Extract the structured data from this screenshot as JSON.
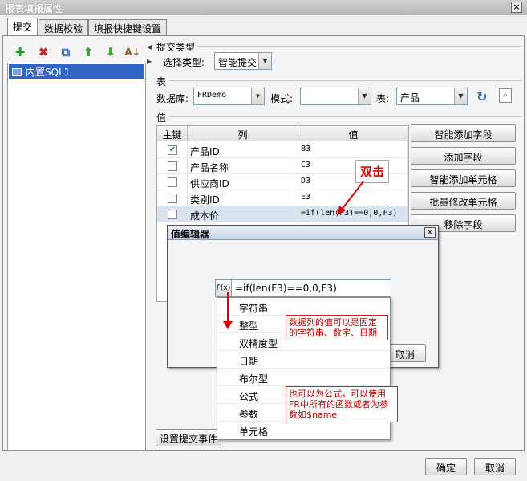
{
  "window": {
    "title": "报表填报属性",
    "close_glyph": "×"
  },
  "tabs": [
    {
      "label": "提交"
    },
    {
      "label": "数据校验"
    },
    {
      "label": "填报快捷键设置"
    }
  ],
  "left_toolbar": {
    "icons": [
      "add-icon",
      "delete-icon",
      "copy-icon",
      "move-up-icon",
      "move-down-icon",
      "sort-icon"
    ]
  },
  "left_list": {
    "items": [
      {
        "label": "内置SQL1"
      }
    ]
  },
  "submit_type": {
    "section": "提交类型",
    "label": "选择类型:",
    "value": "智能提交"
  },
  "table_section": {
    "section": "表",
    "db_label": "数据库:",
    "db_value": "FRDemo",
    "mode_label": "模式:",
    "mode_value": "",
    "table_label": "表:",
    "table_value": "产品"
  },
  "value_section": {
    "section": "值",
    "headers": {
      "key": "主键",
      "col": "列",
      "val": "值"
    },
    "rows": [
      {
        "checked": true,
        "check_glyph": "✔",
        "col": "产品ID",
        "val": "B3"
      },
      {
        "checked": false,
        "check_glyph": "",
        "col": "产品名称",
        "val": "C3"
      },
      {
        "checked": false,
        "check_glyph": "",
        "col": "供应商ID",
        "val": "D3"
      },
      {
        "checked": false,
        "check_glyph": "",
        "col": "类别ID",
        "val": "E3"
      },
      {
        "checked": false,
        "check_glyph": "",
        "col": "成本价",
        "val": "=if(len(F3)==0,0,F3)"
      }
    ]
  },
  "side_buttons": {
    "smart_add_field": "智能添加字段",
    "add_field": "添加字段",
    "smart_add_cell": "智能添加单元格",
    "batch_modify_cell": "批量修改单元格",
    "remove_field": "移除字段"
  },
  "submit_event_button": "设置提交事件",
  "footer": {
    "ok": "确定",
    "cancel": "取消"
  },
  "value_editor": {
    "title": "值编辑器",
    "close_glyph": "×",
    "fx_label": "F(x)",
    "formula": "=if(len(F3)==0,0,F3)",
    "cancel": "取消",
    "menu_items": [
      "字符串",
      "整型",
      "双精度型",
      "日期",
      "布尔型",
      "公式",
      "参数",
      "单元格"
    ]
  },
  "annotations": {
    "callout": "双击",
    "note1": "数据列的值可以是固定的字符串、数字、日期",
    "note2": "也可以为公式，可以使用FR中所有的函数或者为参数如$name"
  },
  "colors": {
    "selection": "#3166c6",
    "annotation_red": "#cc0000"
  }
}
